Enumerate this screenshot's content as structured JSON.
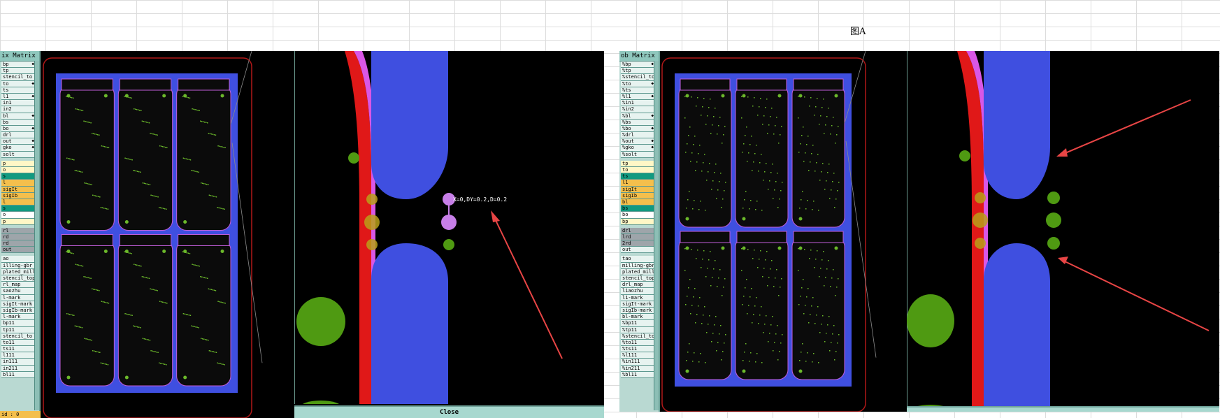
{
  "figure_label": "图A",
  "left_window": {
    "panel_title": "ix Matrix ...",
    "layers": [
      {
        "label": "bp",
        "style": "light",
        "arrow": true
      },
      {
        "label": "tp",
        "style": "light"
      },
      {
        "label": "stencil_to",
        "style": "light"
      },
      {
        "label": "to",
        "style": "light",
        "arrow": true
      },
      {
        "label": "ts",
        "style": "light"
      },
      {
        "label": "l1",
        "style": "light",
        "arrow": true
      },
      {
        "label": "in1",
        "style": "light"
      },
      {
        "label": "in2",
        "style": "light"
      },
      {
        "label": "bl",
        "style": "light",
        "arrow": true
      },
      {
        "label": "bs",
        "style": "light"
      },
      {
        "label": "bo",
        "style": "light",
        "arrow": true
      },
      {
        "label": "drl",
        "style": "light"
      },
      {
        "label": "out",
        "style": "light",
        "arrow": true
      },
      {
        "label": "gko",
        "style": "light",
        "arrow": true
      },
      {
        "label": "solt",
        "style": "light"
      },
      {
        "label": "",
        "style": "sep"
      },
      {
        "label": "p",
        "style": "cream"
      },
      {
        "label": "o",
        "style": "cream"
      },
      {
        "label": "s",
        "style": "teal"
      },
      {
        "label": "l",
        "style": "orange"
      },
      {
        "label": "sigIt",
        "style": "orange"
      },
      {
        "label": "sigIb",
        "style": "orange"
      },
      {
        "label": "l",
        "style": "orange"
      },
      {
        "label": "s",
        "style": "teal"
      },
      {
        "label": "o",
        "style": "white"
      },
      {
        "label": "p",
        "style": "cream"
      },
      {
        "label": "",
        "style": "sep"
      },
      {
        "label": "rl",
        "style": "gray"
      },
      {
        "label": "rd",
        "style": "gray"
      },
      {
        "label": "rd",
        "style": "gray"
      },
      {
        "label": "out",
        "style": "gray"
      },
      {
        "label": "",
        "style": "sep"
      },
      {
        "label": "ao",
        "style": "light"
      },
      {
        "label": "illing-gbr",
        "style": "light"
      },
      {
        "label": "plated_mill",
        "style": "light"
      },
      {
        "label": "stencil_top",
        "style": "light"
      },
      {
        "label": "rl_map",
        "style": "light"
      },
      {
        "label": "saozhu",
        "style": "light"
      },
      {
        "label": "l-mark",
        "style": "light"
      },
      {
        "label": "sigIt-mark",
        "style": "light"
      },
      {
        "label": "sigIb-mark",
        "style": "light"
      },
      {
        "label": "l-mark",
        "style": "light"
      },
      {
        "label": "bp11",
        "style": "light"
      },
      {
        "label": "tp11",
        "style": "light"
      },
      {
        "label": "stencil_to",
        "style": "light"
      },
      {
        "label": "to11",
        "style": "light"
      },
      {
        "label": "ts11",
        "style": "light"
      },
      {
        "label": "l111",
        "style": "light"
      },
      {
        "label": "in111",
        "style": "light"
      },
      {
        "label": "in211",
        "style": "light"
      },
      {
        "label": "bl11",
        "style": "light"
      }
    ],
    "status": "id : 0",
    "measure_text": "X=0,DY=0.2,D=0.2",
    "close_label": "Close"
  },
  "right_window": {
    "panel_title": "ob Matrix ...",
    "layers": [
      {
        "label": "%bp",
        "style": "light",
        "arrow": true
      },
      {
        "label": "%tp",
        "style": "light"
      },
      {
        "label": "%stencil_to",
        "style": "light"
      },
      {
        "label": "%to",
        "style": "light",
        "arrow": true
      },
      {
        "label": "%ts",
        "style": "light"
      },
      {
        "label": "%l1",
        "style": "light",
        "arrow": true
      },
      {
        "label": "%in1",
        "style": "light"
      },
      {
        "label": "%in2",
        "style": "light"
      },
      {
        "label": "%bl",
        "style": "light",
        "arrow": true
      },
      {
        "label": "%bs",
        "style": "light"
      },
      {
        "label": "%bo",
        "style": "light",
        "arrow": true
      },
      {
        "label": "%drl",
        "style": "light"
      },
      {
        "label": "%out",
        "style": "light",
        "arrow": true
      },
      {
        "label": "%gko",
        "style": "light",
        "arrow": true
      },
      {
        "label": "%solt",
        "style": "light"
      },
      {
        "label": "",
        "style": "sep"
      },
      {
        "label": "tp",
        "style": "cream"
      },
      {
        "label": "to",
        "style": "cream"
      },
      {
        "label": "ts",
        "style": "teal"
      },
      {
        "label": "l1",
        "style": "orange"
      },
      {
        "label": "sigIt",
        "style": "orange"
      },
      {
        "label": "sigIb",
        "style": "orange"
      },
      {
        "label": "bl",
        "style": "orange"
      },
      {
        "label": "bs",
        "style": "teal"
      },
      {
        "label": "bo",
        "style": "white"
      },
      {
        "label": "bp",
        "style": "cream"
      },
      {
        "label": "",
        "style": "sep"
      },
      {
        "label": "drl",
        "style": "gray"
      },
      {
        "label": "lrd",
        "style": "gray"
      },
      {
        "label": "2rd",
        "style": "gray"
      },
      {
        "label": "out",
        "style": "light"
      },
      {
        "label": "",
        "style": "sep"
      },
      {
        "label": "tao",
        "style": "light"
      },
      {
        "label": "milling-gbr",
        "style": "light"
      },
      {
        "label": "plated_mill",
        "style": "light"
      },
      {
        "label": "stencil_top",
        "style": "light"
      },
      {
        "label": "drl_map",
        "style": "light"
      },
      {
        "label": "liaozhu",
        "style": "light"
      },
      {
        "label": "l1-mark",
        "style": "light"
      },
      {
        "label": "sigIt-mark",
        "style": "light"
      },
      {
        "label": "sigIb-mark",
        "style": "light"
      },
      {
        "label": "bl-mark",
        "style": "light"
      },
      {
        "label": "%bp11",
        "style": "light"
      },
      {
        "label": "%tp11",
        "style": "light"
      },
      {
        "label": "%stencil_to",
        "style": "light"
      },
      {
        "label": "%to11",
        "style": "light"
      },
      {
        "label": "%ts11",
        "style": "light"
      },
      {
        "label": "%l111",
        "style": "light"
      },
      {
        "label": "%in111",
        "style": "light"
      },
      {
        "label": "%in211",
        "style": "light"
      },
      {
        "label": "%bl11",
        "style": "light"
      }
    ]
  },
  "colors": {
    "background": "#000000",
    "pad_blue": "#3f4fe0",
    "copper_red": "#e01818",
    "outline_magenta": "#d957e6",
    "via_green": "#4f9a12",
    "annotation_arrow": "#e84545",
    "selection_purple": "#c77fe8",
    "panel_teal": "#b9d9d2"
  }
}
